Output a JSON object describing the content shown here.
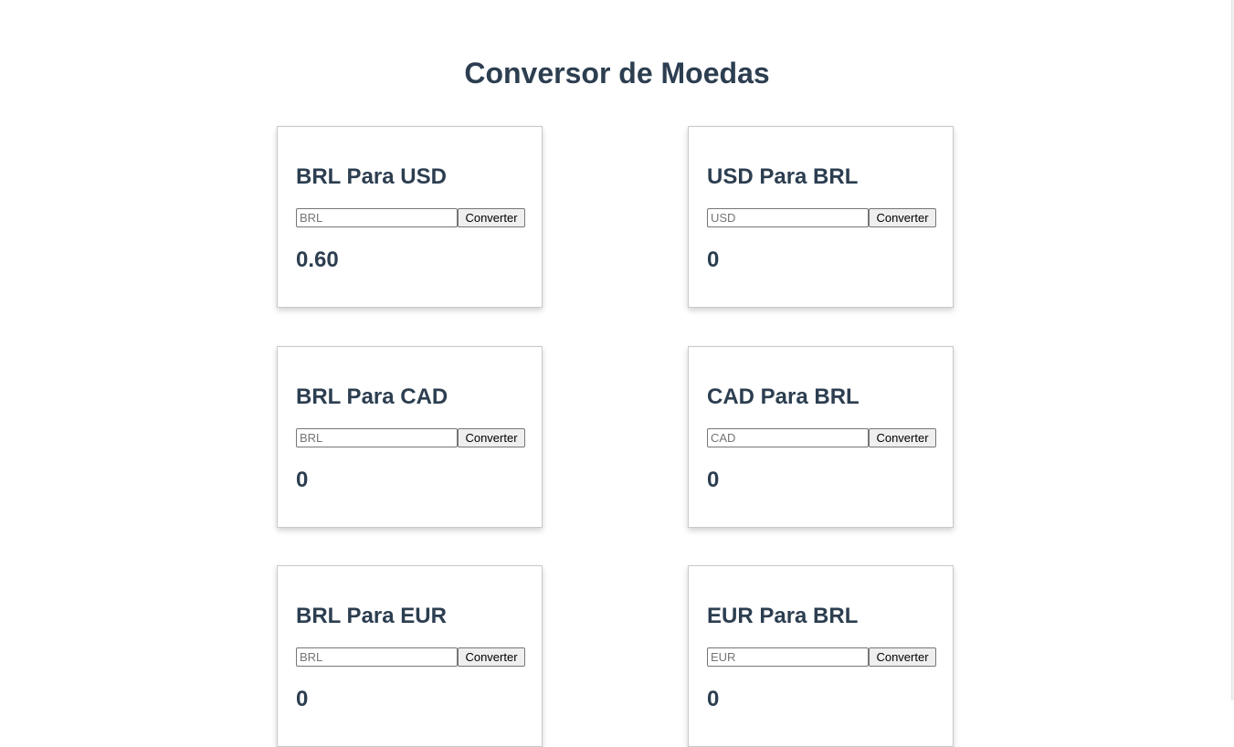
{
  "header": {
    "title": "Conversor de Moedas"
  },
  "cards": [
    {
      "title": "BRL Para USD",
      "placeholder": "BRL",
      "button_label": "Converter",
      "result": "0.60"
    },
    {
      "title": "USD Para BRL",
      "placeholder": "USD",
      "button_label": "Converter",
      "result": "0"
    },
    {
      "title": "BRL Para CAD",
      "placeholder": "BRL",
      "button_label": "Converter",
      "result": "0"
    },
    {
      "title": "CAD Para BRL",
      "placeholder": "CAD",
      "button_label": "Converter",
      "result": "0"
    },
    {
      "title": "BRL Para EUR",
      "placeholder": "BRL",
      "button_label": "Converter",
      "result": "0"
    },
    {
      "title": "EUR Para BRL",
      "placeholder": "EUR",
      "button_label": "Converter",
      "result": "0"
    }
  ]
}
